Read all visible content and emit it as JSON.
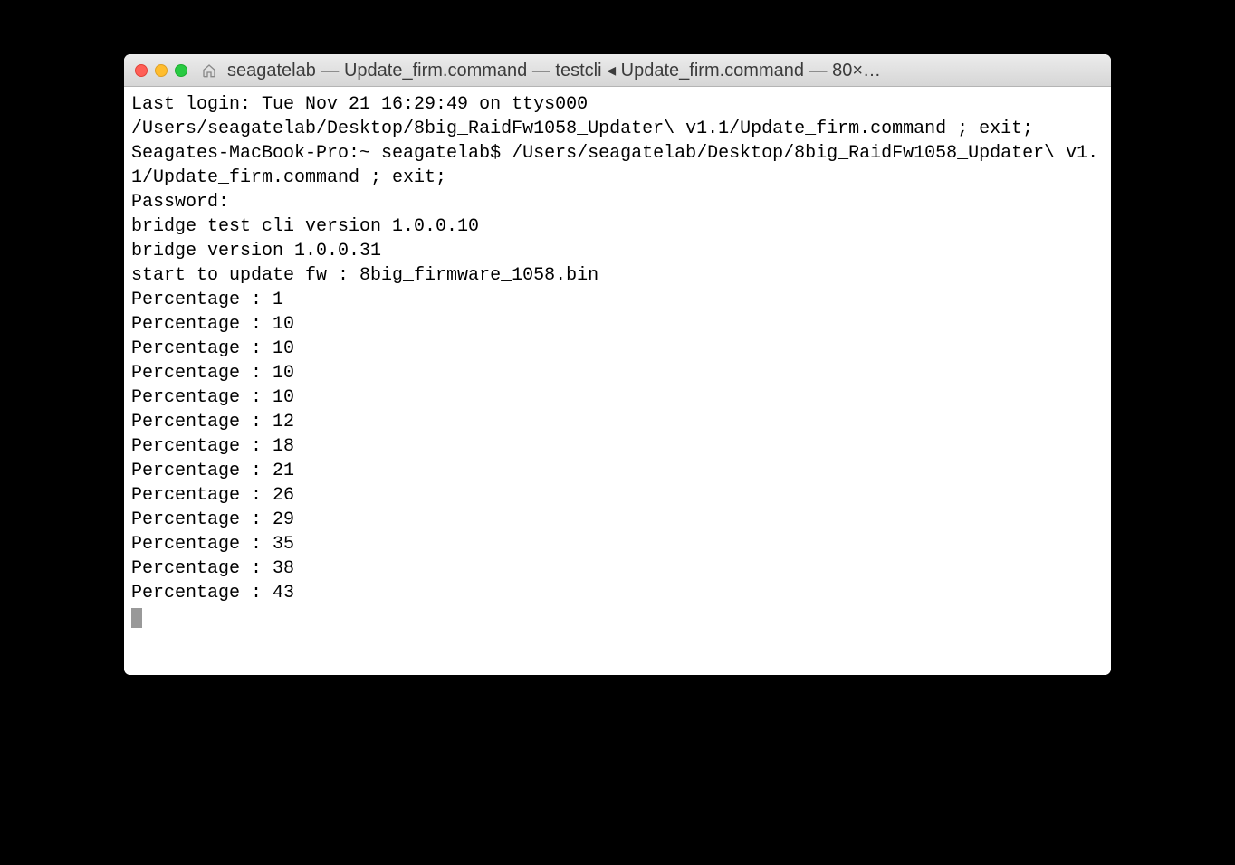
{
  "titlebar": {
    "title": "seagatelab — Update_firm.command — testcli ◂ Update_firm.command — 80×…"
  },
  "terminal": {
    "line1": "Last login: Tue Nov 21 16:29:49 on ttys000",
    "line2": "/Users/seagatelab/Desktop/8big_RaidFw1058_Updater\\ v1.1/Update_firm.command ; exit;",
    "line3": "Seagates-MacBook-Pro:~ seagatelab$ /Users/seagatelab/Desktop/8big_RaidFw1058_Updater\\ v1.1/Update_firm.command ; exit;",
    "line4": "Password:",
    "line5": "bridge test cli version 1.0.0.10",
    "line6": "bridge version 1.0.0.31",
    "line7": "start to update fw : 8big_firmware_1058.bin",
    "percentages": [
      "Percentage : 1",
      "Percentage : 10",
      "Percentage : 10",
      "Percentage : 10",
      "Percentage : 10",
      "Percentage : 12",
      "Percentage : 18",
      "Percentage : 21",
      "Percentage : 26",
      "Percentage : 29",
      "Percentage : 35",
      "Percentage : 38",
      "Percentage : 43"
    ]
  }
}
